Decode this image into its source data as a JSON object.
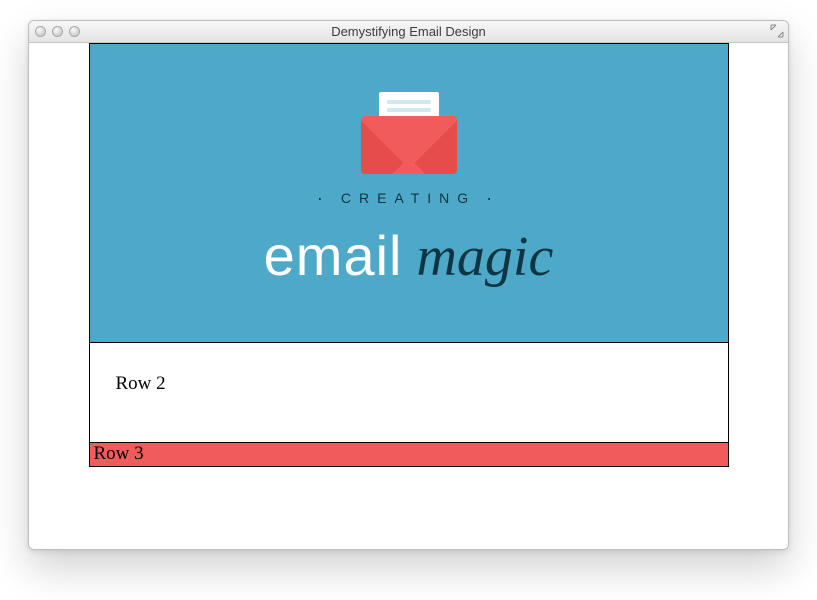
{
  "window": {
    "title": "Demystifying Email Design"
  },
  "hero": {
    "kicker": "CREATING",
    "word1": "email",
    "word2": "magic"
  },
  "rows": {
    "r2": "Row 2",
    "r3": "Row 3"
  }
}
